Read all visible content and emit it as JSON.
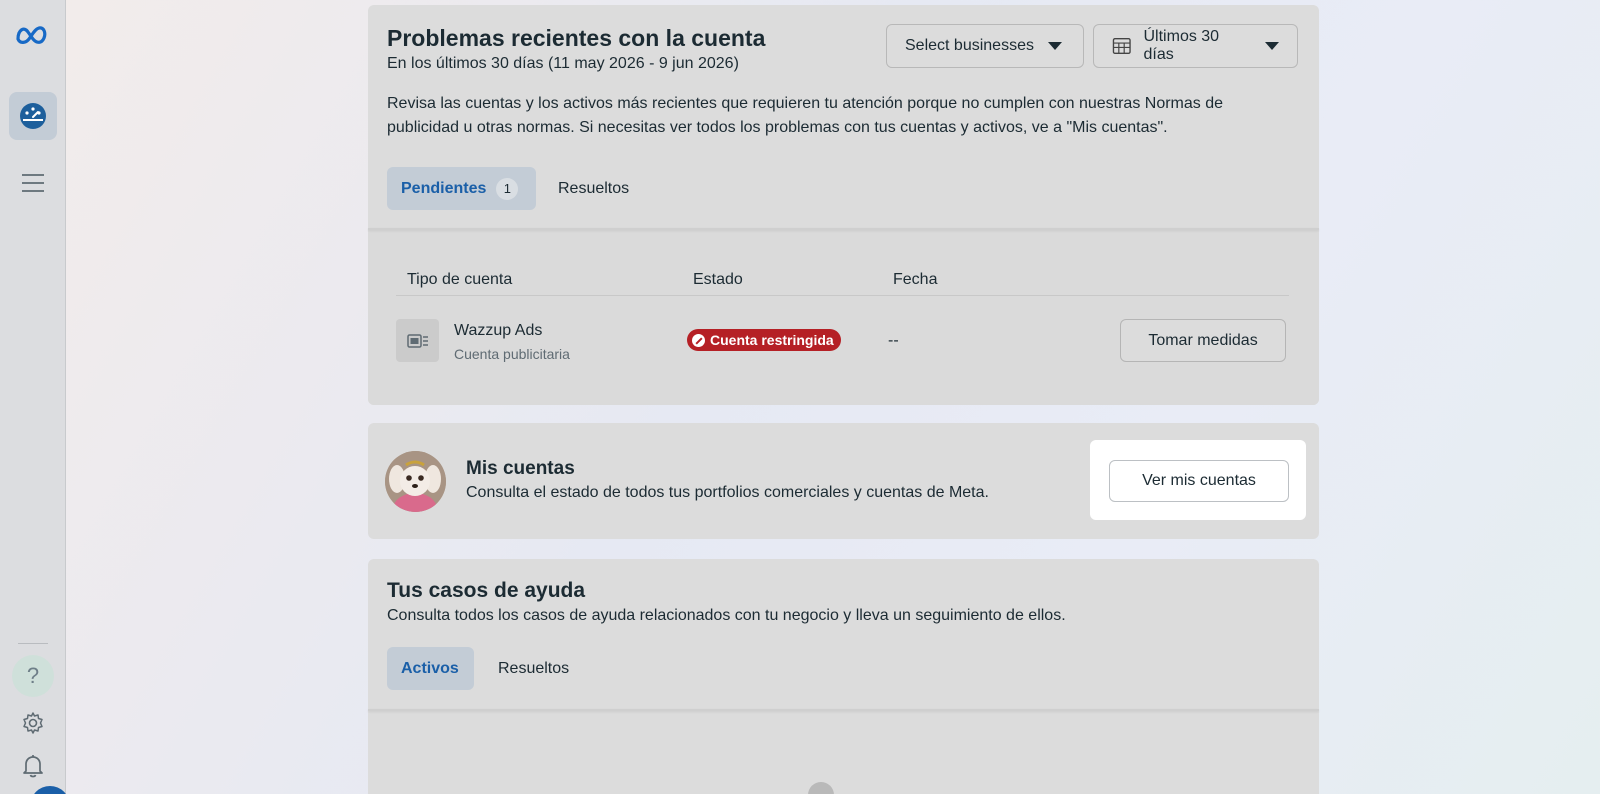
{
  "sidebar": {
    "logo": "meta-logo-icon",
    "items": [
      {
        "icon": "dashboard-icon"
      },
      {
        "icon": "menu-icon"
      },
      {
        "icon": "help-icon",
        "label": "?"
      },
      {
        "icon": "gear-icon"
      },
      {
        "icon": "bell-icon"
      }
    ]
  },
  "problems": {
    "title": "Problemas recientes con la cuenta",
    "subtitle": "En los últimos 30 días (11 may 2026 - 9 jun 2026)",
    "description": "Revisa las cuentas y los activos más recientes que requieren tu atención porque no cumplen con nuestras Normas de publicidad u otras normas. Si necesitas ver todos los problemas con tus cuentas y activos, ve a \"Mis cuentas\".",
    "business_select": "Select businesses",
    "date_range": "Últimos 30 días",
    "tabs": [
      {
        "label": "Pendientes",
        "count": "1"
      },
      {
        "label": "Resueltos"
      }
    ],
    "columns": [
      "Tipo de cuenta",
      "Estado",
      "Fecha"
    ],
    "rows": [
      {
        "name": "Wazzup Ads",
        "type": "Cuenta publicitaria",
        "status": "Cuenta restringida",
        "date": "--",
        "action": "Tomar medidas"
      }
    ]
  },
  "accounts": {
    "title": "Mis cuentas",
    "description": "Consulta el estado de todos tus portfolios comerciales y cuentas de Meta.",
    "button": "Ver mis cuentas"
  },
  "help_cases": {
    "title": "Tus casos de ayuda",
    "description": "Consulta todos los casos de ayuda relacionados con tu negocio y lleva un seguimiento de ellos.",
    "tabs": [
      {
        "label": "Activos"
      },
      {
        "label": "Resueltos"
      }
    ]
  },
  "colors": {
    "accent": "#1a5fa8",
    "danger": "#b52025",
    "overlay_card": "#dcdcdc"
  }
}
